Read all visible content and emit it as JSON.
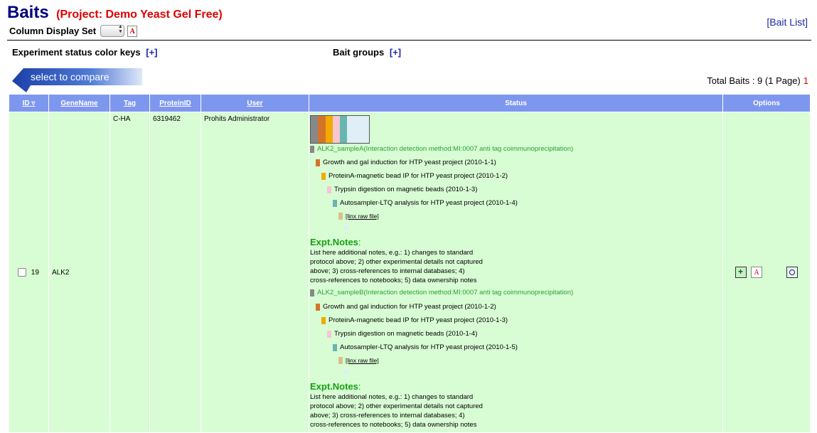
{
  "header": {
    "title": "Baits",
    "project": "(Project: Demo Yeast Gel Free)",
    "column_display_label": "Column Display Set",
    "bait_list_link": "[Bait List]"
  },
  "keys": {
    "experiment_label": "Experiment status color keys",
    "experiment_plus": "[+]",
    "bait_groups_label": "Bait groups",
    "bait_groups_plus": "[+]"
  },
  "compare_button": "select to compare",
  "total": {
    "text": "Total Baits : 9 (1 Page)",
    "page": "1"
  },
  "columns": [
    "ID",
    "GeneName",
    "Tag",
    "ProteinID",
    "User",
    "Status",
    "Options"
  ],
  "row": {
    "id": "19",
    "gene": "ALK2",
    "tag": "C-HA",
    "protein": "6319462",
    "user": "Prohits Administrator"
  },
  "status": {
    "strip_colors": [
      "#888888",
      "#d4742a",
      "#f2a900",
      "#f7c6d0",
      "#69b5b0",
      "#dfeef7"
    ],
    "sampleA": {
      "name": "ALK2_sampleA(Interaction detection method:MI:0007 anti tag coimmunoprecipitation)",
      "steps": [
        "Growth and gal induction for HTP yeast project (2010-1-1)",
        "ProteinA-magnetic bead IP for HTP yeast project (2010-1-2)",
        "Trypsin digestion on magnetic beads (2010-1-3)",
        "Autosampler-LTQ analysis for HTP yeast project (2010-1-4)"
      ],
      "raw": "[linx raw file]"
    },
    "sampleB": {
      "name": "ALK2_sampleB(Interaction detection method:MI:0007 anti tag coimmunoprecipitation)",
      "steps": [
        "Growth and gal induction for HTP yeast project (2010-1-2)",
        "ProteinA-magnetic bead IP for HTP yeast project (2010-1-3)",
        "Trypsin digestion on magnetic beads (2010-1-4)",
        "Autosampler-LTQ analysis for HTP yeast project (2010-1-5)"
      ],
      "raw": "[linx raw file]"
    },
    "notes_title": "Expt.Notes",
    "notes_colon": ":",
    "notes_lines": [
      "List here additional notes, e.g.: 1) changes to standard",
      "protocol above; 2) other experimental details not captured",
      "above; 3) cross-references to internal databases; 4)",
      "cross-references to notebooks; 5) data ownership notes"
    ]
  },
  "icons": [
    "add-icon",
    "pdf-icon",
    "search-icon"
  ]
}
